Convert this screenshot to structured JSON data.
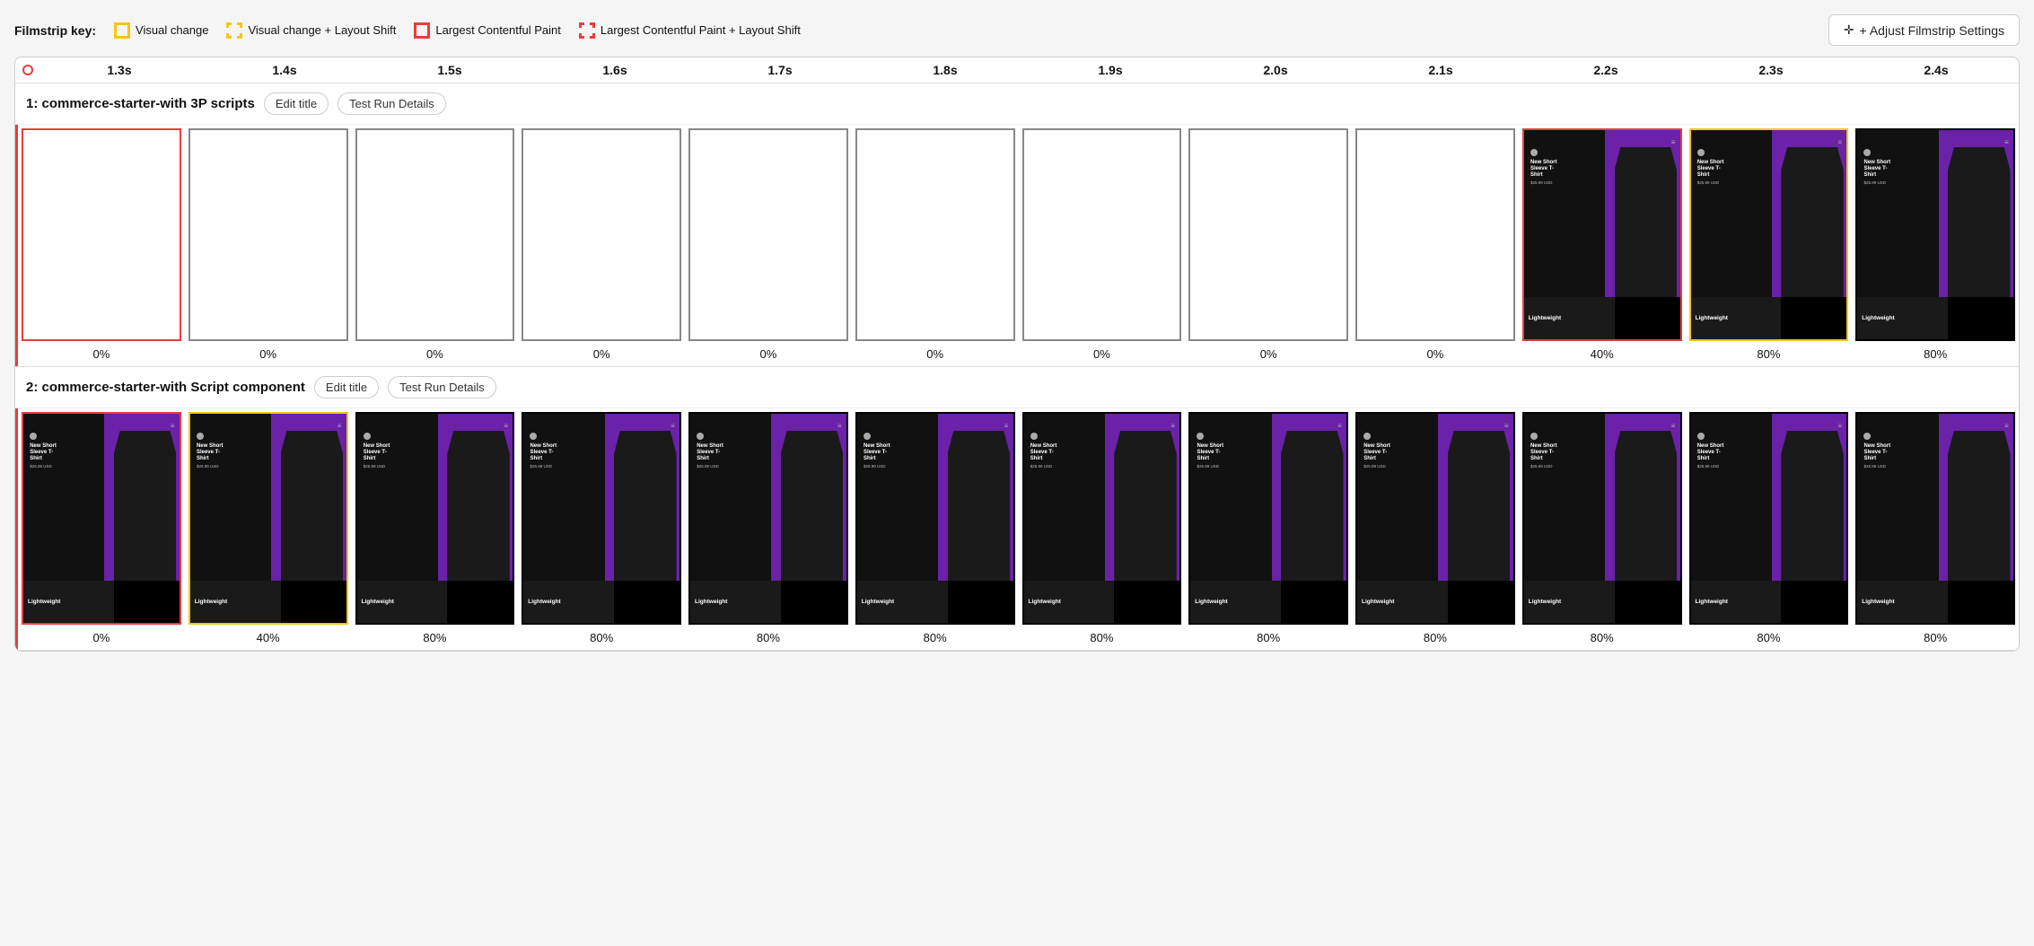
{
  "legend": {
    "label": "Filmstrip key:",
    "items": [
      {
        "id": "visual-change",
        "label": "Visual change",
        "boxType": "solid-yellow"
      },
      {
        "id": "visual-change-layout",
        "label": "Visual change + Layout Shift",
        "boxType": "dashed-yellow"
      },
      {
        "id": "lcp",
        "label": "Largest Contentful Paint",
        "boxType": "solid-red"
      },
      {
        "id": "lcp-layout",
        "label": "Largest Contentful Paint + Layout Shift",
        "boxType": "dashed-red"
      }
    ]
  },
  "adjustBtn": "+ Adjust Filmstrip Settings",
  "timeline": {
    "startDot": true,
    "ticks": [
      "1.3s",
      "1.4s",
      "1.5s",
      "1.6s",
      "1.7s",
      "1.8s",
      "1.9s",
      "2.0s",
      "2.1s",
      "2.2s",
      "2.3s",
      "2.4s"
    ]
  },
  "rows": [
    {
      "id": "row1",
      "title": "1: commerce-starter-with 3P scripts",
      "editLabel": "Edit title",
      "detailsLabel": "Test Run Details",
      "sectionBorder": "red",
      "frames": [
        {
          "empty": true,
          "border": "red",
          "percent": "0%"
        },
        {
          "empty": true,
          "border": "none",
          "percent": "0%"
        },
        {
          "empty": true,
          "border": "none",
          "percent": "0%"
        },
        {
          "empty": true,
          "border": "none",
          "percent": "0%"
        },
        {
          "empty": true,
          "border": "none",
          "percent": "0%"
        },
        {
          "empty": true,
          "border": "none",
          "percent": "0%"
        },
        {
          "empty": true,
          "border": "none",
          "percent": "0%"
        },
        {
          "empty": true,
          "border": "none",
          "percent": "0%"
        },
        {
          "empty": true,
          "border": "none",
          "percent": "0%"
        },
        {
          "empty": false,
          "border": "red",
          "percent": "40%"
        },
        {
          "empty": false,
          "border": "yellow",
          "percent": "80%"
        },
        {
          "empty": false,
          "border": "none",
          "percent": "80%"
        }
      ]
    },
    {
      "id": "row2",
      "title": "2: commerce-starter-with Script component",
      "editLabel": "Edit title",
      "detailsLabel": "Test Run Details",
      "sectionBorder": "red",
      "frames": [
        {
          "empty": false,
          "border": "red",
          "percent": "0%"
        },
        {
          "empty": false,
          "border": "yellow",
          "percent": "40%"
        },
        {
          "empty": false,
          "border": "none",
          "percent": "80%"
        },
        {
          "empty": false,
          "border": "none",
          "percent": "80%"
        },
        {
          "empty": false,
          "border": "none",
          "percent": "80%"
        },
        {
          "empty": false,
          "border": "none",
          "percent": "80%"
        },
        {
          "empty": false,
          "border": "none",
          "percent": "80%"
        },
        {
          "empty": false,
          "border": "none",
          "percent": "80%"
        },
        {
          "empty": false,
          "border": "none",
          "percent": "80%"
        },
        {
          "empty": false,
          "border": "none",
          "percent": "80%"
        },
        {
          "empty": false,
          "border": "none",
          "percent": "80%"
        },
        {
          "empty": false,
          "border": "none",
          "percent": "80%"
        }
      ]
    }
  ]
}
